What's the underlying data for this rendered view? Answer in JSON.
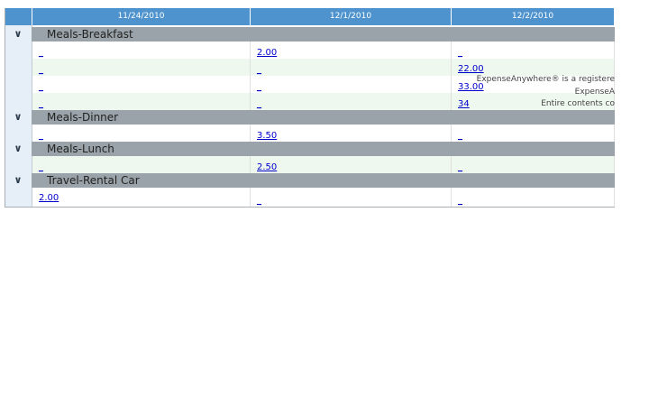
{
  "columns": [
    "11/24/2010",
    "12/1/2010",
    "12/2/2010"
  ],
  "groups": [
    {
      "name": "Meals-Breakfast",
      "rows": [
        [
          "_",
          "2.00",
          "_"
        ],
        [
          "_",
          "_",
          "22.00"
        ],
        [
          "_",
          "_",
          "33.00"
        ],
        [
          "_",
          "_",
          "34"
        ]
      ]
    },
    {
      "name": "Meals-Dinner",
      "rows": [
        [
          "_",
          "3.50",
          "_"
        ]
      ]
    },
    {
      "name": "Meals-Lunch",
      "rows": [
        [
          "_",
          "2.50",
          "_"
        ]
      ]
    },
    {
      "name": "Travel-Rental Car",
      "rows": [
        [
          "2.00",
          "_",
          "_"
        ]
      ]
    }
  ],
  "footer_overlay": {
    "line1": "ExpenseAnywhere® is a registere",
    "line2": "ExpenseA",
    "line3": "Entire contents co"
  },
  "icons": {
    "collapse": "chevron-down-icon"
  }
}
